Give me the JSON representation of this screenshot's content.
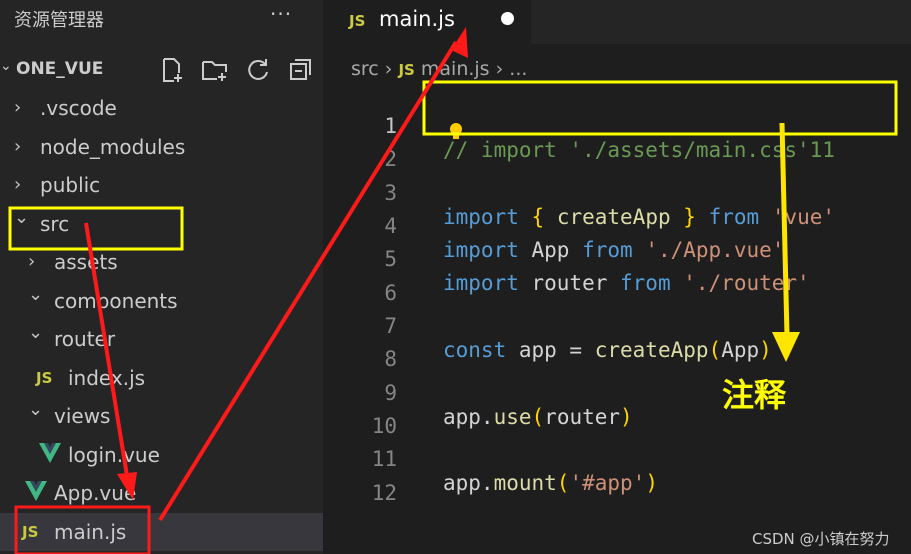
{
  "sidebar": {
    "title": "资源管理器",
    "more": "···",
    "project": "ONE_VUE",
    "tree": [
      {
        "label": ".vscode",
        "chevron": "›"
      },
      {
        "label": "node_modules",
        "chevron": "›"
      },
      {
        "label": "public",
        "chevron": "›"
      },
      {
        "label": "src",
        "chevron": "⌄"
      },
      {
        "label": "assets",
        "chevron": "›"
      },
      {
        "label": "components",
        "chevron": "⌄"
      },
      {
        "label": "router",
        "chevron": "⌄"
      },
      {
        "label": "index.js",
        "icon": "JS"
      },
      {
        "label": "views",
        "chevron": "⌄"
      },
      {
        "label": "login.vue",
        "icon": "vue-icon"
      },
      {
        "label": "App.vue",
        "icon": "vue-icon"
      },
      {
        "label": "main.js",
        "icon": "JS"
      }
    ]
  },
  "editor": {
    "tab": {
      "icon": "JS",
      "name": "main.js",
      "modified": true
    },
    "breadcrumb": {
      "folder": "src",
      "sep": "›",
      "icon": "JS",
      "file": "main.js",
      "more": "› ..."
    },
    "lines": [
      {
        "n": "1",
        "text": "// import './assets/main.css'11"
      },
      {
        "n": "2",
        "text": ""
      },
      {
        "n": "3",
        "text": "import { createApp } from 'vue'"
      },
      {
        "n": "4",
        "text": "import App from './App.vue'"
      },
      {
        "n": "5",
        "text": "import router from './router'"
      },
      {
        "n": "6",
        "text": ""
      },
      {
        "n": "7",
        "text": "const app = createApp(App)"
      },
      {
        "n": "8",
        "text": ""
      },
      {
        "n": "9",
        "text": "app.use(router)"
      },
      {
        "n": "10",
        "text": ""
      },
      {
        "n": "11",
        "text": "app.mount('#app')"
      },
      {
        "n": "12",
        "text": ""
      }
    ]
  },
  "annotation": "注释",
  "watermark": "CSDN @小镇在努力",
  "colors": {
    "highlight_box": "#ffff00",
    "arrow_red": "#ff1a1a",
    "arrow_yellow": "#ffe600"
  }
}
